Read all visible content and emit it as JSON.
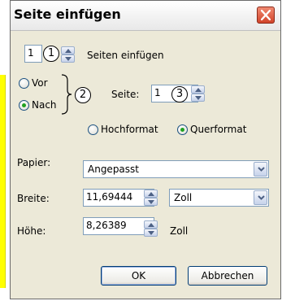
{
  "dialog": {
    "title": "Seite einfügen",
    "close_icon": "close-x-icon",
    "close_color": "#d2442a"
  },
  "count": {
    "value": "1",
    "callout": "1",
    "label": "Seiten einfügen"
  },
  "position": {
    "before_label": "Vor",
    "after_label": "Nach",
    "selected": "Nach",
    "callout": "2"
  },
  "page": {
    "label": "Seite:",
    "value": "1",
    "callout": "3"
  },
  "orientation": {
    "portrait_label": "Hochformat",
    "landscape_label": "Querformat",
    "selected": "Querformat"
  },
  "paper": {
    "label": "Papier:",
    "value": "Angepasst"
  },
  "width": {
    "label": "Breite:",
    "value": "11,69444",
    "unit": "Zoll"
  },
  "height": {
    "label": "Höhe:",
    "value": "8,26389",
    "unit": "Zoll"
  },
  "buttons": {
    "ok": "OK",
    "cancel": "Abbrechen"
  },
  "colors": {
    "dialog_bg": "#ece9d8",
    "highlight_bar": "#ffff00",
    "radio_dot": "#21a121",
    "field_border": "#7f9db9"
  }
}
